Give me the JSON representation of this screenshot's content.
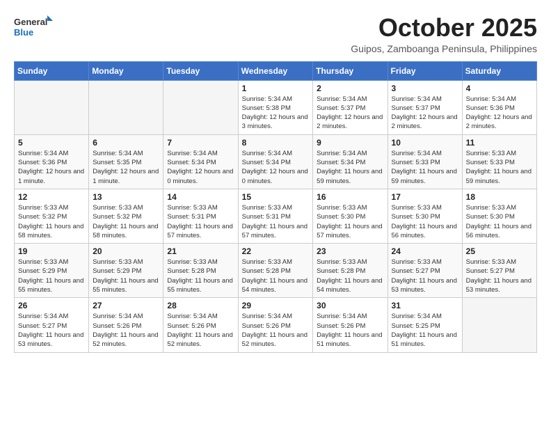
{
  "header": {
    "logo_general": "General",
    "logo_blue": "Blue",
    "month_year": "October 2025",
    "location": "Guipos, Zamboanga Peninsula, Philippines"
  },
  "days_of_week": [
    "Sunday",
    "Monday",
    "Tuesday",
    "Wednesday",
    "Thursday",
    "Friday",
    "Saturday"
  ],
  "weeks": [
    [
      {
        "day": "",
        "info": ""
      },
      {
        "day": "",
        "info": ""
      },
      {
        "day": "",
        "info": ""
      },
      {
        "day": "1",
        "info": "Sunrise: 5:34 AM\nSunset: 5:38 PM\nDaylight: 12 hours and 3 minutes."
      },
      {
        "day": "2",
        "info": "Sunrise: 5:34 AM\nSunset: 5:37 PM\nDaylight: 12 hours and 2 minutes."
      },
      {
        "day": "3",
        "info": "Sunrise: 5:34 AM\nSunset: 5:37 PM\nDaylight: 12 hours and 2 minutes."
      },
      {
        "day": "4",
        "info": "Sunrise: 5:34 AM\nSunset: 5:36 PM\nDaylight: 12 hours and 2 minutes."
      }
    ],
    [
      {
        "day": "5",
        "info": "Sunrise: 5:34 AM\nSunset: 5:36 PM\nDaylight: 12 hours and 1 minute."
      },
      {
        "day": "6",
        "info": "Sunrise: 5:34 AM\nSunset: 5:35 PM\nDaylight: 12 hours and 1 minute."
      },
      {
        "day": "7",
        "info": "Sunrise: 5:34 AM\nSunset: 5:34 PM\nDaylight: 12 hours and 0 minutes."
      },
      {
        "day": "8",
        "info": "Sunrise: 5:34 AM\nSunset: 5:34 PM\nDaylight: 12 hours and 0 minutes."
      },
      {
        "day": "9",
        "info": "Sunrise: 5:34 AM\nSunset: 5:34 PM\nDaylight: 11 hours and 59 minutes."
      },
      {
        "day": "10",
        "info": "Sunrise: 5:34 AM\nSunset: 5:33 PM\nDaylight: 11 hours and 59 minutes."
      },
      {
        "day": "11",
        "info": "Sunrise: 5:33 AM\nSunset: 5:33 PM\nDaylight: 11 hours and 59 minutes."
      }
    ],
    [
      {
        "day": "12",
        "info": "Sunrise: 5:33 AM\nSunset: 5:32 PM\nDaylight: 11 hours and 58 minutes."
      },
      {
        "day": "13",
        "info": "Sunrise: 5:33 AM\nSunset: 5:32 PM\nDaylight: 11 hours and 58 minutes."
      },
      {
        "day": "14",
        "info": "Sunrise: 5:33 AM\nSunset: 5:31 PM\nDaylight: 11 hours and 57 minutes."
      },
      {
        "day": "15",
        "info": "Sunrise: 5:33 AM\nSunset: 5:31 PM\nDaylight: 11 hours and 57 minutes."
      },
      {
        "day": "16",
        "info": "Sunrise: 5:33 AM\nSunset: 5:30 PM\nDaylight: 11 hours and 57 minutes."
      },
      {
        "day": "17",
        "info": "Sunrise: 5:33 AM\nSunset: 5:30 PM\nDaylight: 11 hours and 56 minutes."
      },
      {
        "day": "18",
        "info": "Sunrise: 5:33 AM\nSunset: 5:30 PM\nDaylight: 11 hours and 56 minutes."
      }
    ],
    [
      {
        "day": "19",
        "info": "Sunrise: 5:33 AM\nSunset: 5:29 PM\nDaylight: 11 hours and 55 minutes."
      },
      {
        "day": "20",
        "info": "Sunrise: 5:33 AM\nSunset: 5:29 PM\nDaylight: 11 hours and 55 minutes."
      },
      {
        "day": "21",
        "info": "Sunrise: 5:33 AM\nSunset: 5:28 PM\nDaylight: 11 hours and 55 minutes."
      },
      {
        "day": "22",
        "info": "Sunrise: 5:33 AM\nSunset: 5:28 PM\nDaylight: 11 hours and 54 minutes."
      },
      {
        "day": "23",
        "info": "Sunrise: 5:33 AM\nSunset: 5:28 PM\nDaylight: 11 hours and 54 minutes."
      },
      {
        "day": "24",
        "info": "Sunrise: 5:33 AM\nSunset: 5:27 PM\nDaylight: 11 hours and 53 minutes."
      },
      {
        "day": "25",
        "info": "Sunrise: 5:33 AM\nSunset: 5:27 PM\nDaylight: 11 hours and 53 minutes."
      }
    ],
    [
      {
        "day": "26",
        "info": "Sunrise: 5:34 AM\nSunset: 5:27 PM\nDaylight: 11 hours and 53 minutes."
      },
      {
        "day": "27",
        "info": "Sunrise: 5:34 AM\nSunset: 5:26 PM\nDaylight: 11 hours and 52 minutes."
      },
      {
        "day": "28",
        "info": "Sunrise: 5:34 AM\nSunset: 5:26 PM\nDaylight: 11 hours and 52 minutes."
      },
      {
        "day": "29",
        "info": "Sunrise: 5:34 AM\nSunset: 5:26 PM\nDaylight: 11 hours and 52 minutes."
      },
      {
        "day": "30",
        "info": "Sunrise: 5:34 AM\nSunset: 5:26 PM\nDaylight: 11 hours and 51 minutes."
      },
      {
        "day": "31",
        "info": "Sunrise: 5:34 AM\nSunset: 5:25 PM\nDaylight: 11 hours and 51 minutes."
      },
      {
        "day": "",
        "info": ""
      }
    ]
  ]
}
